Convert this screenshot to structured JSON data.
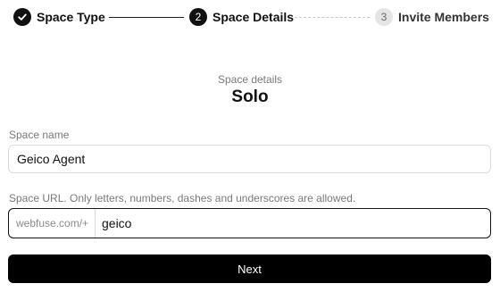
{
  "stepper": {
    "steps": [
      {
        "label": "Space Type",
        "state": "done",
        "icon": "check-icon"
      },
      {
        "label": "Space Details",
        "number": "2",
        "state": "active"
      },
      {
        "label": "Invite Members",
        "number": "3",
        "state": "pending"
      }
    ]
  },
  "header": {
    "subtitle": "Space details",
    "title": "Solo"
  },
  "form": {
    "space_name": {
      "label": "Space name",
      "value": "Geico Agent"
    },
    "space_url": {
      "label": "Space URL. Only letters, numbers, dashes and underscores are allowed.",
      "prefix": "webfuse.com/+",
      "value": "geico"
    },
    "next_label": "Next"
  },
  "colors": {
    "primary": "#000000",
    "pending_step_bg": "#e4e4e4",
    "muted_text": "#7a7a7a"
  }
}
